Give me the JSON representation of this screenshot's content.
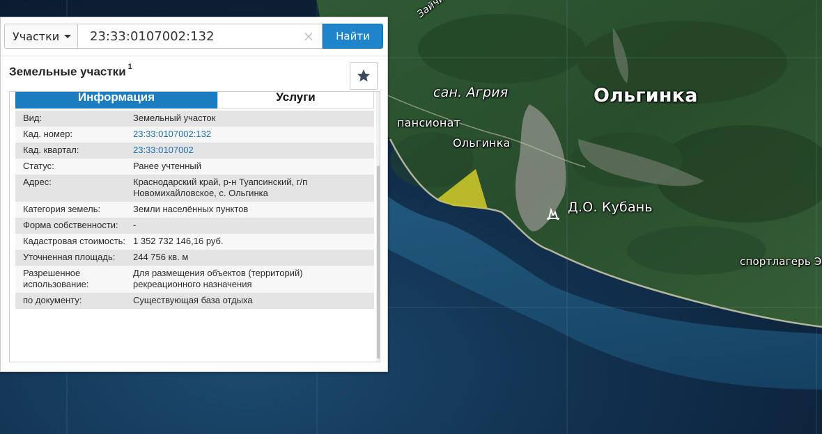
{
  "map": {
    "labels": {
      "road": "Зайчине",
      "town": "Ольгинка",
      "sanatorium": "сан. Агрия",
      "pension": "пансионат",
      "pension_name": "Ольгинка",
      "resort": "Д.О. Кубань",
      "sport_camp": "спортлагерь Эле"
    },
    "colors": {
      "sea_deep": "#0b1e33",
      "sea_shallow": "#1b4f75",
      "forest": "#2b4f2c",
      "parcel_fill": "#c9c42a"
    },
    "icons": {
      "resort": "resort-icon"
    }
  },
  "search": {
    "type_label": "Участки",
    "query": "23:33:0107002:132",
    "clear_icon": "×",
    "button_label": "Найти"
  },
  "panel": {
    "title": "Земельные участки",
    "count": "1",
    "fav_icon": "star-icon",
    "tabs": {
      "info": "Информация",
      "services": "Услуги"
    },
    "rows": [
      {
        "key": "Вид:",
        "value": "Земельный участок"
      },
      {
        "key": "Кад. номер:",
        "value": "23:33:0107002:132"
      },
      {
        "key": "Кад. квартал:",
        "value": "23:33:0107002"
      },
      {
        "key": "Статус:",
        "value": "Ранее учтенный"
      },
      {
        "key": "Адрес:",
        "value": "Краснодарский край, р-н Туапсинский, г/п Новомихайловское, с. Ольгинка"
      },
      {
        "key": "Категория земель:",
        "value": "Земли населённых пунктов"
      },
      {
        "key": "Форма собственности:",
        "value": "-"
      },
      {
        "key": "Кадастровая стоимость:",
        "value": "1 352 732 146,16 руб."
      },
      {
        "key": "Уточненная площадь:",
        "value": "244 756 кв. м"
      },
      {
        "key": "Разрешенное использование:",
        "value": "Для размещения объектов (территорий) рекреационного назначения"
      },
      {
        "key": "по документу:",
        "value": "Существующая база отдыха"
      }
    ]
  }
}
